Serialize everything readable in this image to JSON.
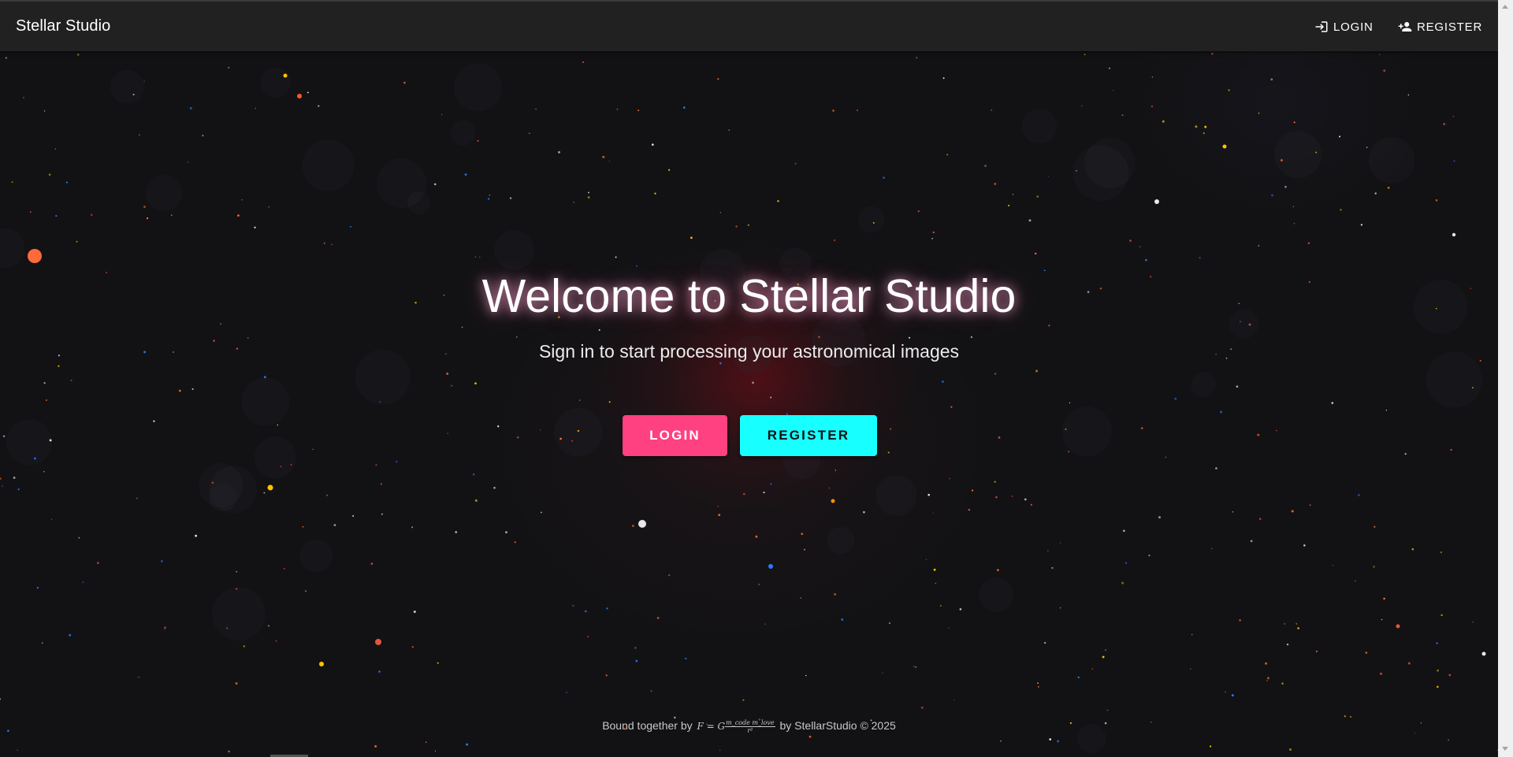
{
  "app": {
    "brand": "Stellar Studio"
  },
  "nav": {
    "login_label": "LOGIN",
    "login_icon": "login-icon",
    "register_label": "REGISTER",
    "register_icon": "person-add-icon"
  },
  "hero": {
    "title": "Welcome to Stellar Studio",
    "subtitle": "Sign in to start processing your astronomical images",
    "login_label": "LOGIN",
    "register_label": "REGISTER"
  },
  "footer": {
    "prefix": "Bound together by",
    "formula_lhs": "F = G",
    "formula_numerator": "m_code m_love",
    "formula_denominator": "r²",
    "suffix": "by StellarStudio © 2025"
  },
  "colors": {
    "background": "#121214",
    "appbar": "#212121",
    "login_button": "#ff4081",
    "register_button": "#18ffff",
    "star_white": "#e8e8e8",
    "star_orange": "#ff6a3a",
    "star_yellow": "#ffc400",
    "star_blue": "#2979ff"
  }
}
